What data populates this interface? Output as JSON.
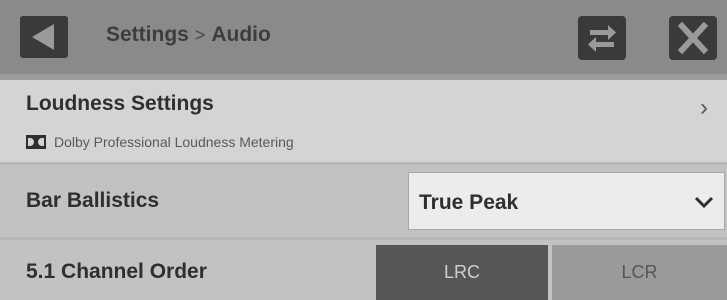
{
  "header": {
    "breadcrumb_parent": "Settings",
    "breadcrumb_separator": ">",
    "breadcrumb_current": "Audio"
  },
  "loudness": {
    "title": "Loudness Settings",
    "subtitle": "Dolby Professional Loudness Metering",
    "chevron": "›"
  },
  "ballistics": {
    "label": "Bar Ballistics",
    "selected": "True Peak"
  },
  "channel_order": {
    "label": "5.1 Channel Order",
    "options": [
      "LRC",
      "LCR"
    ],
    "selected": "LRC"
  },
  "icons": {
    "back": "back-arrow-icon",
    "swap": "swap-arrows-icon",
    "close": "close-icon",
    "dolby": "dolby-logo-icon",
    "dropdown": "chevron-down-icon"
  },
  "colors": {
    "header_bg": "#8a8a8a",
    "button_bg": "#3a3a3a",
    "selected_segment": "#565656",
    "unselected_segment": "#9a9a9a"
  }
}
